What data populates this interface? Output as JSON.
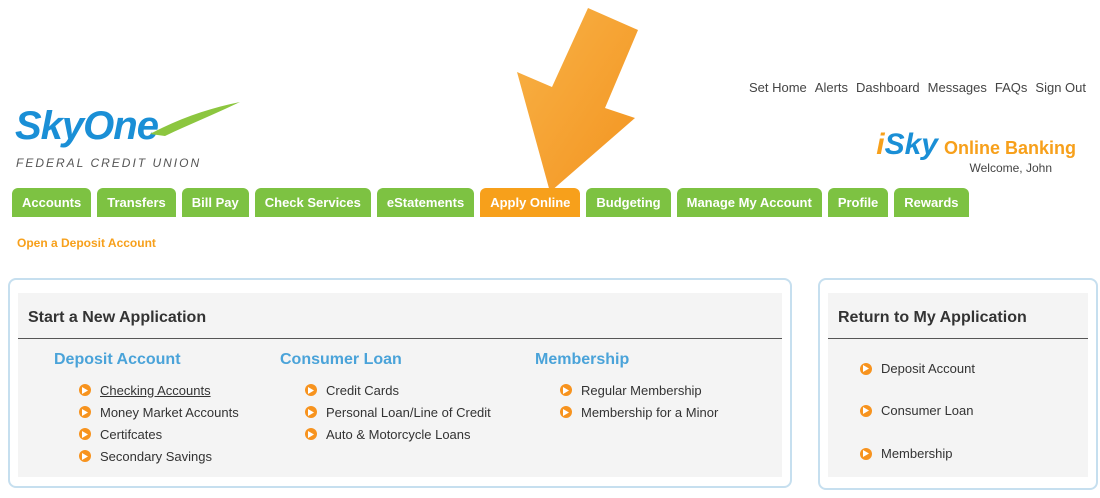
{
  "top_links": [
    "Set Home",
    "Alerts",
    "Dashboard",
    "Messages",
    "FAQs",
    "Sign Out"
  ],
  "logo": {
    "main": "SkyOne",
    "main_a": "Sky",
    "main_b": "One",
    "sub": "FEDERAL CREDIT UNION"
  },
  "banner": {
    "brand": "iSky",
    "brand_i": "i",
    "brand_rest": "Sky",
    "text": "Online Banking",
    "welcome": "Welcome, John"
  },
  "nav": {
    "tabs": [
      "Accounts",
      "Transfers",
      "Bill Pay",
      "Check Services",
      "eStatements",
      "Apply Online",
      "Budgeting",
      "Manage My Account",
      "Profile",
      "Rewards"
    ],
    "active": "Apply Online",
    "sub": "Open a Deposit Account"
  },
  "new_app": {
    "title": "Start a New Application",
    "columns": [
      {
        "title": "Deposit Account",
        "items": [
          "Checking Accounts",
          "Money Market Accounts",
          "Certifcates",
          "Secondary Savings"
        ]
      },
      {
        "title": "Consumer Loan",
        "items": [
          "Credit Cards",
          "Personal Loan/Line of Credit",
          "Auto & Motorcycle Loans"
        ]
      },
      {
        "title": "Membership",
        "items": [
          "Regular Membership",
          "Membership for a Minor"
        ]
      }
    ]
  },
  "return_app": {
    "title": "Return to My Application",
    "items": [
      "Deposit Account",
      "Consumer Loan",
      "Membership"
    ]
  },
  "colors": {
    "green": "#7dc242",
    "orange": "#f7a01b",
    "blue": "#1a8fd6",
    "light_blue": "#4aa3d9"
  }
}
